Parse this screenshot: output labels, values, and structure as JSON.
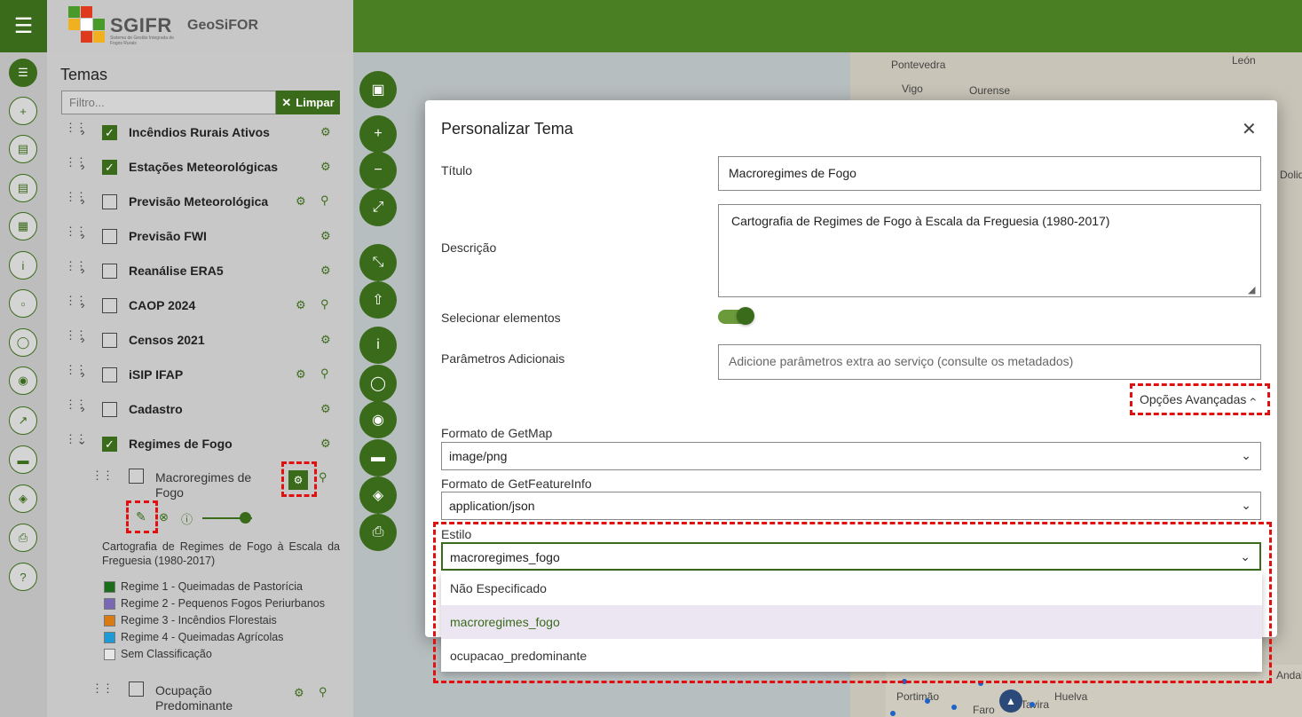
{
  "brand": {
    "logo_text": "SGIFR",
    "logo_subtitle": "Sistema de Gestão Integrada de Fogos Rurais",
    "app_name": "GeoSiFOR"
  },
  "panel": {
    "title": "Temas",
    "filter_placeholder": "Filtro...",
    "clear_label": "Limpar",
    "layers": [
      {
        "name": "Incêndios Rurais Ativos",
        "checked": true
      },
      {
        "name": "Estações Meteorológicas",
        "checked": true
      },
      {
        "name": "Previsão Meteorológica",
        "checked": false
      },
      {
        "name": "Previsão FWI",
        "checked": false
      },
      {
        "name": "Reanálise ERA5",
        "checked": false
      },
      {
        "name": "CAOP 2024",
        "checked": false
      },
      {
        "name": "Censos 2021",
        "checked": false
      },
      {
        "name": "iSIP IFAP",
        "checked": false
      },
      {
        "name": "Cadastro",
        "checked": false
      },
      {
        "name": "Regimes de Fogo",
        "checked": true
      }
    ],
    "sublayer": {
      "name": "Macroregimes de Fogo",
      "opacity": 0.85,
      "description": "Cartografia de Regimes de Fogo à Escala da Freguesia (1980-2017)",
      "legend": [
        {
          "label": "Regime 1 - Queimadas de Pastorícia",
          "color": "#1a6e1a"
        },
        {
          "label": "Regime 2 - Pequenos Fogos Periurbanos",
          "color": "#7b68b5"
        },
        {
          "label": "Regime 3 - Incêndios Florestais",
          "color": "#d97a12"
        },
        {
          "label": "Regime 4 - Queimadas Agrícolas",
          "color": "#1e9ad6"
        },
        {
          "label": "Sem Classificação",
          "color": "#e6e6e6"
        }
      ]
    },
    "next_sublayer": {
      "name": "Ocupação Predominante"
    }
  },
  "map": {
    "labels": [
      "Pontevedra",
      "Vigo",
      "Ourense",
      "León",
      "Portimão",
      "Faro",
      "Huelva",
      "Tavira",
      "Andalu",
      "Dolid"
    ]
  },
  "dialog": {
    "title": "Personalizar Tema",
    "fields": {
      "title_label": "Título",
      "title_value": "Macroregimes de Fogo",
      "description_label": "Descrição",
      "description_value": "Cartografia de Regimes de Fogo à Escala da Freguesia (1980-2017)",
      "select_label": "Selecionar elementos",
      "select_enabled": true,
      "params_label": "Parâmetros Adicionais",
      "params_placeholder": "Adicione parâmetros extra ao serviço (consulte os metadados)",
      "advanced_label": "Opções Avançadas",
      "getmap_label": "Formato de GetMap",
      "getmap_value": "image/png",
      "getfeature_label": "Formato de GetFeatureInfo",
      "getfeature_value": "application/json",
      "style_label": "Estilo",
      "style_value": "macroregimes_fogo"
    },
    "style_options": [
      "Não Especificado",
      "macroregimes_fogo",
      "ocupacao_predominante"
    ],
    "selected_style_option": "macroregimes_fogo"
  }
}
